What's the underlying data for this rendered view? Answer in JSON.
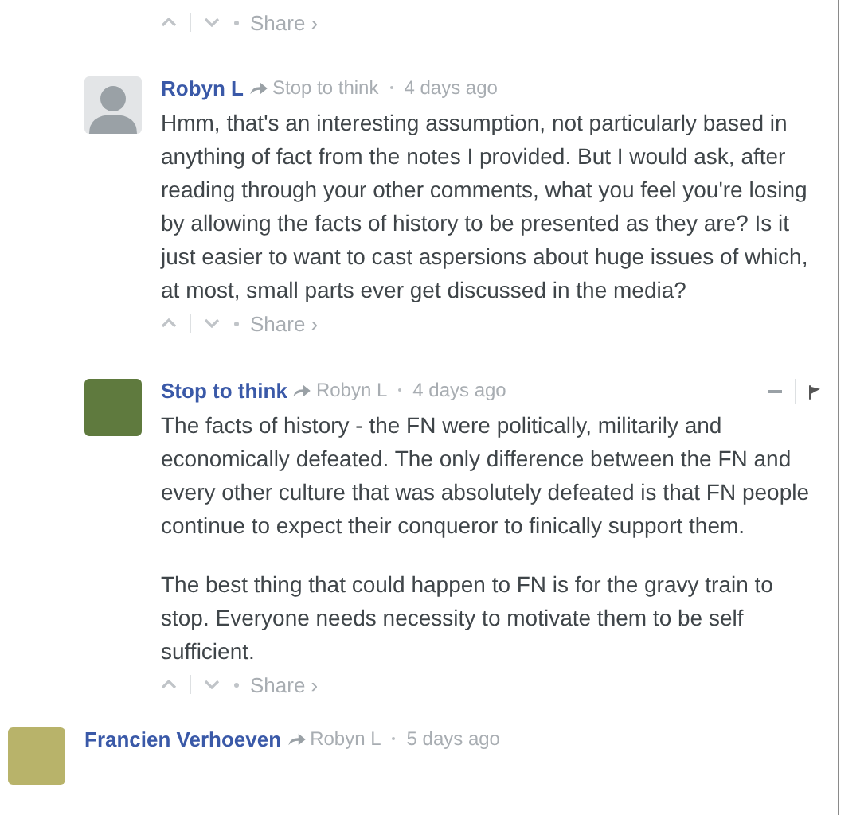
{
  "comments": [
    {
      "children": [
        {
          "share": "Share ›"
        },
        {
          "author": "Robyn L",
          "reply_to": "Stop to think",
          "time": "4 days ago",
          "avatar": {
            "kind": "default"
          },
          "hovered": false,
          "paragraphs": [
            "Hmm, that's an interesting assumption, not particularly based in anything of fact from the notes I provided. But I would ask, after reading through your other comments, what you feel you're losing by allowing the facts of history to be presented as they are? Is it just easier to want to cast aspersions about huge issues of which, at most, small parts ever get discussed in the media?"
          ],
          "share": "Share ›"
        },
        {
          "author": "Stop to think",
          "reply_to": "Robyn L",
          "time": "4 days ago",
          "avatar": {
            "kind": "photo"
          },
          "hovered": true,
          "paragraphs": [
            "The facts of history - the FN were politically, militarily and economically defeated. The only difference between the FN and every other culture that was absolutely defeated is that FN people continue to expect their conqueror to finically support them.",
            "The best thing that could happen to FN is for the gravy train to stop. Everyone needs necessity to motivate them to be self sufficient."
          ],
          "share": "Share ›"
        }
      ]
    },
    {
      "author": "Francien Verhoeven",
      "reply_to": "Robyn L",
      "time": "5 days ago",
      "avatar": {
        "kind": "photo"
      },
      "hovered": false
    }
  ]
}
